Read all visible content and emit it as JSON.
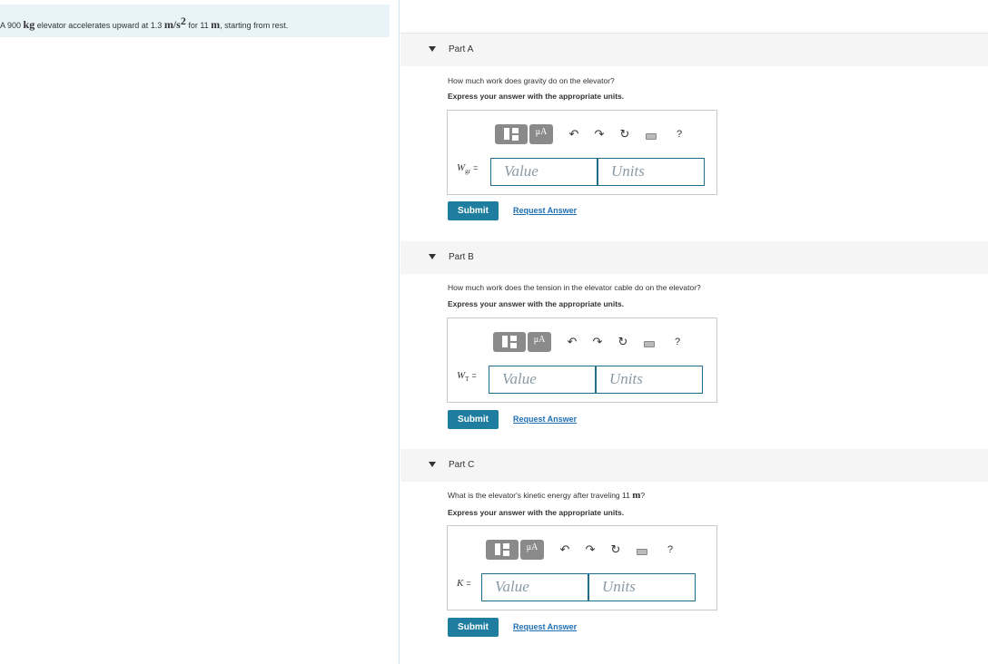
{
  "problem": {
    "text_pre": "A 900 ",
    "u1": "kg",
    "text_mid1": " elevator accelerates upward at 1.3 ",
    "u2": "m/s",
    "u2_exp": "2",
    "text_mid2": " for 11 ",
    "u3": "m",
    "text_post": ", starting from rest."
  },
  "parts": [
    {
      "title": "Part A",
      "question": "How much work does gravity do on the elevator?",
      "question_math": "",
      "question_end": "",
      "express": "Express your answer with the appropriate units.",
      "var_main": "W",
      "var_sub": "gr",
      "eq": "=",
      "value_placeholder": "Value",
      "units_placeholder": "Units",
      "submit": "Submit",
      "request": "Request Answer"
    },
    {
      "title": "Part B",
      "question": "How much work does the tension in the elevator cable do on the elevator?",
      "question_math": "",
      "question_end": "",
      "express": "Express your answer with the appropriate units.",
      "var_main": "W",
      "var_sub": "T",
      "eq": "=",
      "value_placeholder": "Value",
      "units_placeholder": "Units",
      "submit": "Submit",
      "request": "Request Answer"
    },
    {
      "title": "Part C",
      "question": "What is the elevator's kinetic energy after traveling 11 ",
      "question_math": "m",
      "question_end": "?",
      "express": "Express your answer with the appropriate units.",
      "var_main": "K",
      "var_sub": "",
      "eq": "=",
      "value_placeholder": "Value",
      "units_placeholder": "Units",
      "submit": "Submit",
      "request": "Request Answer"
    }
  ],
  "toolbar": {
    "units_btn": "μA",
    "undo": "↶",
    "redo": "↷",
    "reset": "↻",
    "help": "?"
  }
}
